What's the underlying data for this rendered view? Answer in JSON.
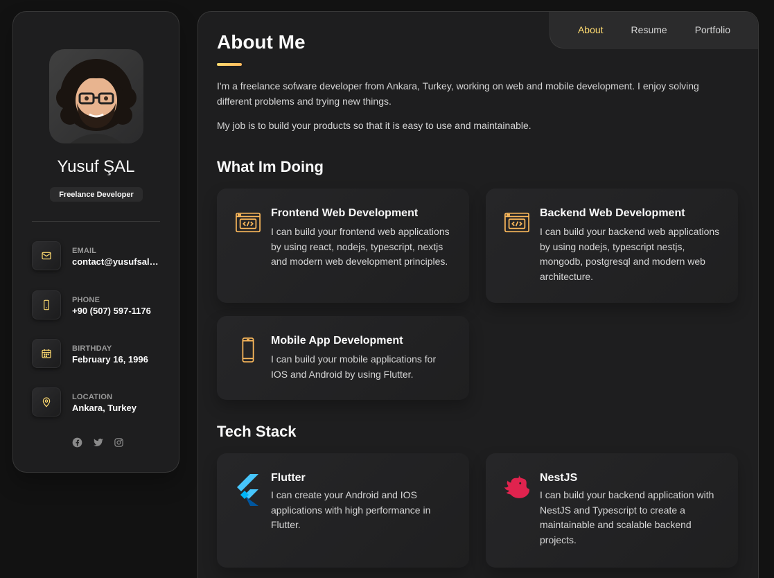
{
  "profile": {
    "name": "Yusuf ŞAL",
    "title": "Freelance Developer",
    "avatar_icon": "memoji-avatar"
  },
  "contacts": [
    {
      "label": "Email",
      "value": "contact@yusufsal.c...",
      "icon": "mail-icon"
    },
    {
      "label": "Phone",
      "value": "+90 (507) 597-1176",
      "icon": "phone-icon"
    },
    {
      "label": "Birthday",
      "value": "February 16, 1996",
      "icon": "calendar-icon"
    },
    {
      "label": "Location",
      "value": "Ankara, Turkey",
      "icon": "location-pin-icon"
    }
  ],
  "socials": [
    "facebook-icon",
    "twitter-icon",
    "instagram-icon"
  ],
  "nav": {
    "items": [
      {
        "label": "About",
        "active": true
      },
      {
        "label": "Resume",
        "active": false
      },
      {
        "label": "Portfolio",
        "active": false
      }
    ]
  },
  "about": {
    "title": "About Me",
    "paragraphs": [
      "I'm a freelance sofware developer from Ankara, Turkey, working on web and mobile development. I enjoy solving different problems and trying new things.",
      "My job is to build your products so that it is easy to use and maintainable."
    ]
  },
  "services": {
    "title": "What Im Doing",
    "items": [
      {
        "title": "Frontend Web Development",
        "text": "I can build your frontend web applications by using react, nodejs, typescript, nextjs and modern web development principles.",
        "icon": "code-browser-icon"
      },
      {
        "title": "Backend Web Development",
        "text": "I can build your backend web applications by using nodejs, typescript nestjs, mongodb, postgresql and modern web architecture.",
        "icon": "code-browser-icon"
      },
      {
        "title": "Mobile App Development",
        "text": "I can build your mobile applications for IOS and Android by using Flutter.",
        "icon": "mobile-phone-icon"
      }
    ]
  },
  "tech": {
    "title": "Tech Stack",
    "items": [
      {
        "title": "Flutter",
        "text": "I can create your Android and IOS applications with high performance in Flutter.",
        "icon": "flutter-logo-icon"
      },
      {
        "title": "NestJS",
        "text": "I can build your backend application with NestJS and Typescript to create a maintainable and scalable backend projects.",
        "icon": "nestjs-logo-icon"
      }
    ]
  },
  "colors": {
    "accent": "#ffdb70",
    "background": "#121212",
    "card": "#1e1e1f",
    "flutter_blue": "#47c5fb",
    "nestjs_red": "#e0234e"
  }
}
